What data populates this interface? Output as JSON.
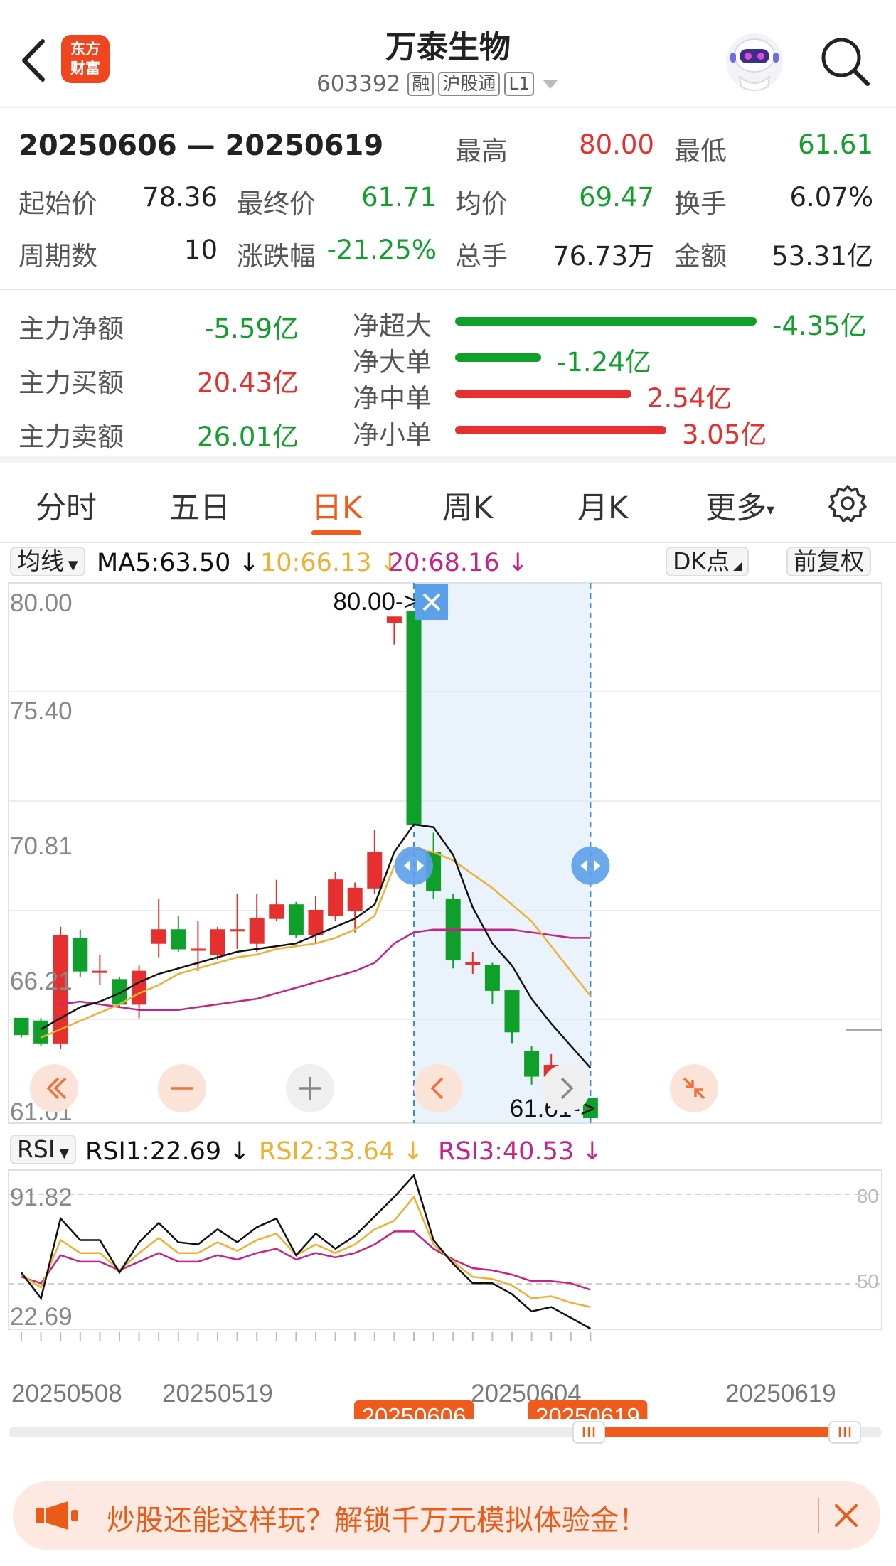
{
  "header": {
    "title": "万泰生物",
    "code": "603392",
    "tags": [
      "融",
      "沪股通",
      "L1"
    ],
    "logo_text": [
      "东方",
      "财富"
    ],
    "icons": [
      "back-arrow-icon",
      "robot-avatar-icon",
      "search-icon"
    ]
  },
  "summary": {
    "range": "20250606 — 20250619",
    "high_label": "最高",
    "high": "80.00",
    "low_label": "最低",
    "low": "61.61",
    "start_label": "起始价",
    "start": "78.36",
    "end_label": "最终价",
    "end": "61.71",
    "avg_label": "均价",
    "avg": "69.47",
    "turnover_label": "换手",
    "turnover": "6.07%",
    "periods_label": "周期数",
    "periods": "10",
    "change_label": "涨跌幅",
    "change": "-21.25%",
    "volume_label": "总手",
    "volume": "76.73万",
    "amount_label": "金额",
    "amount": "53.31亿"
  },
  "flow": {
    "net_label": "主力净额",
    "net": "-5.59亿",
    "buy_label": "主力买额",
    "buy": "20.43亿",
    "sell_label": "主力卖额",
    "sell": "26.01亿",
    "items": [
      {
        "label": "净超大",
        "value": "-4.35亿",
        "amount": -4.35,
        "color": "#0fa02b"
      },
      {
        "label": "净大单",
        "value": "-1.24亿",
        "amount": -1.24,
        "color": "#0fa02b"
      },
      {
        "label": "净中单",
        "value": "2.54亿",
        "amount": 2.54,
        "color": "#e5302f"
      },
      {
        "label": "净小单",
        "value": "3.05亿",
        "amount": 3.05,
        "color": "#e5302f"
      }
    ]
  },
  "tabs": [
    "分时",
    "五日",
    "日K",
    "周K",
    "月K",
    "更多"
  ],
  "active_tab": "日K",
  "ma": {
    "selector": "均线",
    "ma5": "MA5:63.50 ↓",
    "ma10": "10:66.13 ↓",
    "ma20": "20:68.16 ↓",
    "dk": "DK点",
    "adjust": "前复权"
  },
  "colors": {
    "up": "#e5302f",
    "down": "#0fa02b",
    "ma5": "#111111",
    "ma10": "#eeb030",
    "ma20": "#c8228a",
    "accent": "#f05a1a"
  },
  "kchart": {
    "y_labels": [
      "80.00",
      "75.40",
      "70.81",
      "66.21",
      "61.61"
    ],
    "ylim": [
      61.61,
      80.0
    ],
    "high_marker": "80.00->",
    "low_marker": "61.61->",
    "candles": [
      {
        "o": 65.3,
        "c": 64.7,
        "h": 65.3,
        "l": 64.6
      },
      {
        "o": 65.2,
        "c": 64.4,
        "h": 65.3,
        "l": 64.3
      },
      {
        "o": 64.4,
        "c": 68.3,
        "h": 68.6,
        "l": 64.2
      },
      {
        "o": 68.2,
        "c": 67.0,
        "h": 68.5,
        "l": 66.8
      },
      {
        "o": 67.0,
        "c": 67.0,
        "h": 67.6,
        "l": 66.5
      },
      {
        "o": 66.7,
        "c": 65.8,
        "h": 66.8,
        "l": 65.7
      },
      {
        "o": 65.8,
        "c": 67.0,
        "h": 67.2,
        "l": 65.3
      },
      {
        "o": 68.0,
        "c": 68.5,
        "h": 69.6,
        "l": 67.5
      },
      {
        "o": 68.5,
        "c": 67.8,
        "h": 69.0,
        "l": 67.7
      },
      {
        "o": 67.8,
        "c": 67.8,
        "h": 68.8,
        "l": 67.0
      },
      {
        "o": 67.6,
        "c": 68.5,
        "h": 68.6,
        "l": 67.4
      },
      {
        "o": 68.5,
        "c": 68.5,
        "h": 69.8,
        "l": 67.8
      },
      {
        "o": 68.0,
        "c": 68.9,
        "h": 69.8,
        "l": 67.7
      },
      {
        "o": 68.9,
        "c": 69.4,
        "h": 70.3,
        "l": 68.8
      },
      {
        "o": 69.4,
        "c": 68.3,
        "h": 69.5,
        "l": 68.2
      },
      {
        "o": 68.3,
        "c": 69.2,
        "h": 69.7,
        "l": 68.0
      },
      {
        "o": 69.0,
        "c": 70.3,
        "h": 70.6,
        "l": 68.8
      },
      {
        "o": 69.2,
        "c": 70.0,
        "h": 70.2,
        "l": 68.4
      },
      {
        "o": 70.0,
        "c": 71.3,
        "h": 72.1,
        "l": 69.8
      },
      {
        "o": 79.6,
        "c": 79.8,
        "h": 79.8,
        "l": 78.8
      },
      {
        "o": 80.0,
        "c": 72.3,
        "h": 80.0,
        "l": 72.3
      },
      {
        "o": 71.3,
        "c": 69.9,
        "h": 72.0,
        "l": 69.6
      },
      {
        "o": 69.6,
        "c": 67.4,
        "h": 69.8,
        "l": 67.1
      },
      {
        "o": 67.3,
        "c": 67.3,
        "h": 67.7,
        "l": 66.9
      },
      {
        "o": 67.2,
        "c": 66.3,
        "h": 67.3,
        "l": 65.8
      },
      {
        "o": 66.3,
        "c": 64.8,
        "h": 66.3,
        "l": 64.4
      },
      {
        "o": 64.1,
        "c": 63.2,
        "h": 64.3,
        "l": 62.9
      },
      {
        "o": 63.2,
        "c": 63.6,
        "h": 64.0,
        "l": 63.1
      },
      {
        "o": 63.1,
        "c": 62.2,
        "h": 63.1,
        "l": 62.1
      },
      {
        "o": 62.4,
        "c": 61.7,
        "h": 62.4,
        "l": 61.6
      }
    ],
    "ma5": [
      null,
      64.9,
      65.3,
      65.7,
      65.9,
      66.2,
      66.6,
      66.9,
      67.1,
      67.3,
      67.5,
      67.7,
      67.8,
      67.9,
      68.0,
      68.3,
      68.6,
      68.9,
      69.4,
      71.3,
      72.3,
      72.2,
      71.2,
      69.3,
      68.0,
      67.2,
      66.0,
      65.1,
      64.3,
      63.5
    ],
    "ma10": [
      null,
      64.6,
      64.9,
      65.2,
      65.5,
      65.8,
      66.2,
      66.5,
      66.9,
      67.1,
      67.3,
      67.5,
      67.6,
      67.8,
      67.9,
      68.0,
      68.2,
      68.5,
      69.0,
      70.8,
      71.4,
      71.3,
      71.0,
      70.5,
      70.0,
      69.4,
      68.8,
      67.9,
      67.0,
      66.1
    ],
    "ma20": [
      null,
      null,
      65.8,
      65.9,
      65.8,
      65.7,
      65.6,
      65.6,
      65.6,
      65.7,
      65.8,
      65.9,
      66.0,
      66.2,
      66.4,
      66.6,
      66.8,
      67.0,
      67.3,
      68.0,
      68.4,
      68.5,
      68.5,
      68.5,
      68.5,
      68.5,
      68.4,
      68.3,
      68.2,
      68.2
    ],
    "controls": [
      "double-left-icon",
      "minus-icon",
      "plus-icon",
      "chevron-left-icon",
      "chevron-right-icon",
      "collapse-icon"
    ]
  },
  "rsi": {
    "selector": "RSI",
    "rsi1": "RSI1:22.69 ↓",
    "rsi2": "RSI2:33.64 ↓",
    "rsi3": "RSI3:40.53 ↓",
    "y_top": "91.82",
    "y_bottom": "22.69",
    "ref80": "80",
    "ref50": "50",
    "ylim": [
      22.69,
      91.82
    ],
    "rsi1_values": [
      49,
      37,
      74,
      64,
      64,
      49,
      63,
      72,
      63,
      62,
      69,
      63,
      70,
      74,
      57,
      67,
      60,
      66,
      75,
      84,
      94,
      64,
      53,
      44,
      44,
      39,
      31,
      33,
      28,
      23
    ],
    "rsi2_values": [
      48,
      42,
      64,
      58,
      58,
      50,
      58,
      65,
      58,
      58,
      63,
      59,
      64,
      67,
      57,
      62,
      58,
      62,
      69,
      73,
      84,
      62,
      54,
      47,
      46,
      43,
      37,
      38,
      35,
      33
    ],
    "rsi3_values": [
      47,
      44,
      57,
      54,
      54,
      50,
      54,
      58,
      54,
      54,
      57,
      55,
      58,
      60,
      55,
      58,
      56,
      58,
      62,
      68,
      68,
      60,
      55,
      51,
      50,
      48,
      45,
      45,
      44,
      41
    ]
  },
  "dates": {
    "d1": "20250508",
    "d2": "20250519",
    "d3": "20250604",
    "d4": "20250619",
    "sel_start": "20250606",
    "sel_end": "20250619"
  },
  "banner": {
    "text": "炒股还能这样玩？解锁千万元模拟体验金！"
  }
}
